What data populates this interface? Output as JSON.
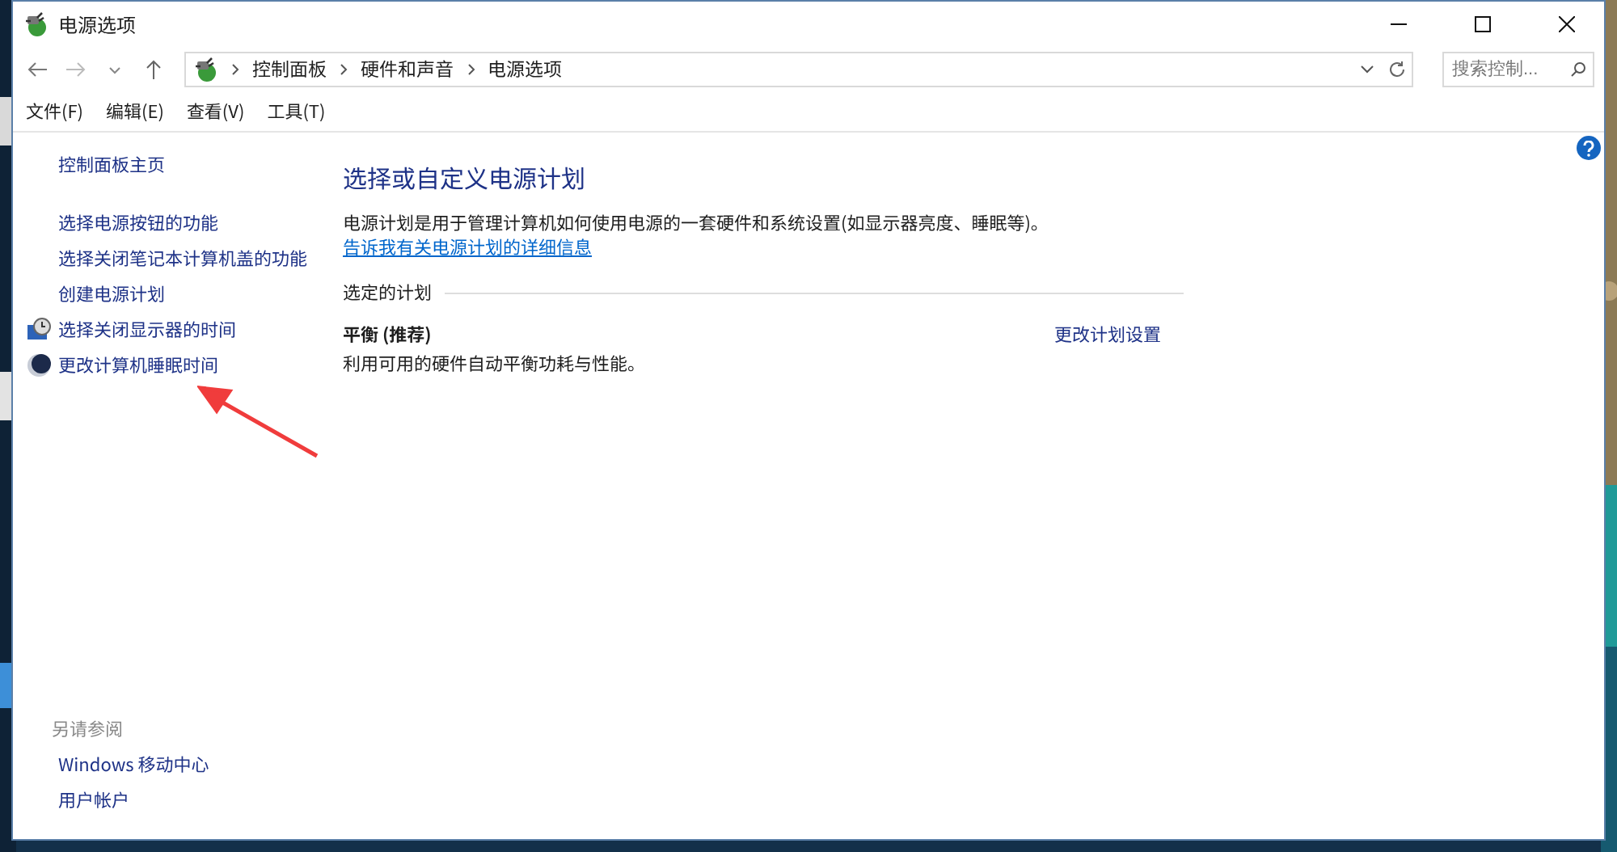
{
  "window": {
    "title": "电源选项"
  },
  "address": {
    "crumbs": [
      "控制面板",
      "硬件和声音",
      "电源选项"
    ]
  },
  "search": {
    "placeholder": "搜索控制..."
  },
  "menu": [
    "文件(F)",
    "编辑(E)",
    "查看(V)",
    "工具(T)"
  ],
  "sidebar": {
    "home": "控制面板主页",
    "tasks": [
      {
        "kind": "text",
        "label": "选择电源按钮的功能"
      },
      {
        "kind": "text",
        "label": "选择关闭笔记本计算机盖的功能"
      },
      {
        "kind": "text",
        "label": "创建电源计划"
      },
      {
        "kind": "monitor",
        "label": "选择关闭显示器的时间"
      },
      {
        "kind": "moon",
        "label": "更改计算机睡眠时间"
      }
    ],
    "see_also": {
      "heading": "另请参阅",
      "links": [
        "Windows 移动中心",
        "用户帐户"
      ]
    }
  },
  "main": {
    "heading": "选择或自定义电源计划",
    "description": "电源计划是用于管理计算机如何使用电源的一套硬件和系统设置(如显示器亮度、睡眠等)。",
    "description_link": "告诉我有关电源计划的详细信息",
    "section": "选定的计划",
    "plans": [
      {
        "name": "平衡 (推荐)",
        "description": "利用可用的硬件自动平衡功耗与性能。",
        "action": "更改计划设置"
      }
    ]
  }
}
